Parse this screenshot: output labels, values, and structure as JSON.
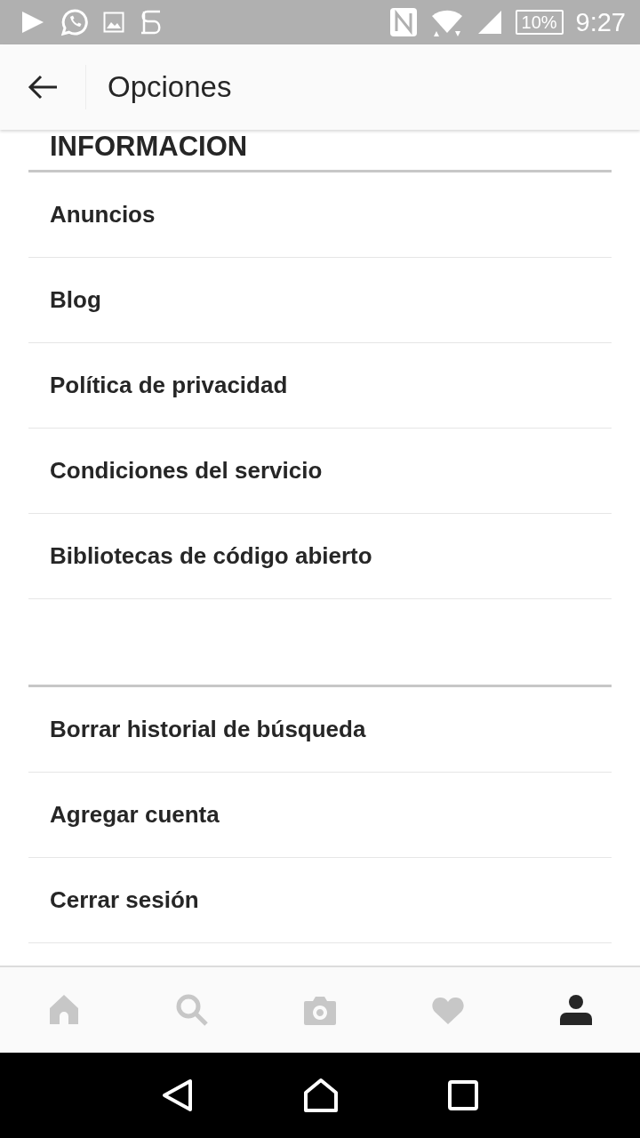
{
  "status_bar": {
    "battery": "10%",
    "time": "9:27"
  },
  "header": {
    "title": "Opciones"
  },
  "sections": [
    {
      "title": "INFORMACION",
      "items": [
        "Anuncios",
        "Blog",
        "Política de privacidad",
        "Condiciones del servicio",
        "Bibliotecas de código abierto"
      ]
    },
    {
      "items": [
        "Borrar historial de búsqueda",
        "Agregar cuenta",
        "Cerrar sesión"
      ]
    }
  ],
  "bottom_nav": [
    {
      "kind": "home",
      "selected": false
    },
    {
      "kind": "search",
      "selected": false
    },
    {
      "kind": "camera",
      "selected": false
    },
    {
      "kind": "heart",
      "selected": false
    },
    {
      "kind": "profile",
      "selected": true
    }
  ]
}
